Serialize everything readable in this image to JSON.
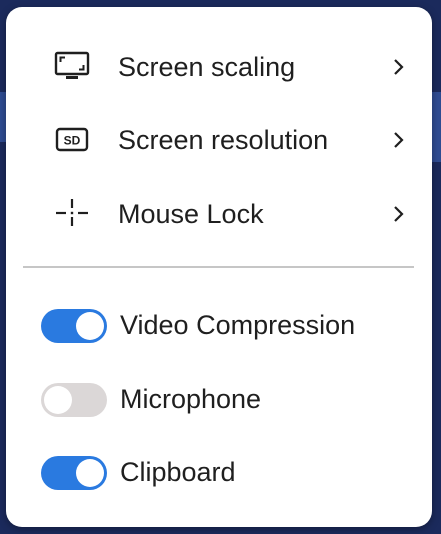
{
  "menu": {
    "items": [
      {
        "label": "Screen scaling",
        "icon": "screen-scaling-icon"
      },
      {
        "label": "Screen resolution",
        "icon": "screen-resolution-icon",
        "icon_text": "SD"
      },
      {
        "label": "Mouse Lock",
        "icon": "mouse-lock-icon"
      }
    ],
    "toggles": [
      {
        "label": "Video Compression",
        "state": "on"
      },
      {
        "label": "Microphone",
        "state": "off"
      },
      {
        "label": "Clipboard",
        "state": "on"
      }
    ]
  },
  "colors": {
    "accent": "#2a7ae0",
    "toggle_off": "#dbd7d7",
    "backdrop": "#1b2a5c",
    "menu_bg": "#ffffff"
  }
}
